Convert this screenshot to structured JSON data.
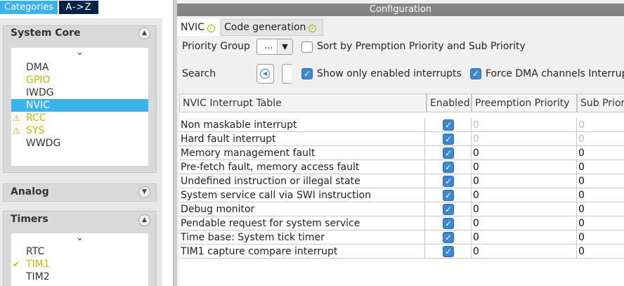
{
  "left": {
    "tabs": {
      "categories": "Categories",
      "az": "A->Z"
    },
    "system_core": {
      "title": "System Core",
      "items": [
        {
          "label": "DMA",
          "state": "normal"
        },
        {
          "label": "GPIO",
          "state": "ok-color"
        },
        {
          "label": "IWDG",
          "state": "normal"
        },
        {
          "label": "NVIC",
          "state": "selected"
        },
        {
          "label": "RCC",
          "state": "warning"
        },
        {
          "label": "SYS",
          "state": "warning"
        },
        {
          "label": "WWDG",
          "state": "normal"
        }
      ]
    },
    "analog": {
      "title": "Analog"
    },
    "timers": {
      "title": "Timers",
      "items": [
        {
          "label": "RTC",
          "state": "normal"
        },
        {
          "label": "TIM1",
          "state": "ok"
        },
        {
          "label": "TIM2",
          "state": "normal"
        }
      ]
    }
  },
  "config": {
    "title": "Configuration",
    "tabs": [
      {
        "label": "NVIC",
        "status": "ok"
      },
      {
        "label": "Code generation",
        "status": "ok"
      }
    ],
    "priority_group": {
      "label": "Priority Group",
      "value": "..."
    },
    "sort_option": {
      "label": "Sort by Premption Priority and Sub Priority",
      "checked": false
    },
    "search": {
      "label": "Search"
    },
    "show_enabled": {
      "label": "Show only enabled interrupts",
      "checked": true
    },
    "force_dma": {
      "label": "Force DMA channels Interrup",
      "checked": true
    },
    "table": {
      "headers": [
        "NVIC Interrupt Table",
        "Enabled",
        "Preemption Priority",
        "Sub Priority"
      ],
      "rows": [
        {
          "name": "Non maskable interrupt",
          "enabled": true,
          "preemption": "0",
          "sub": "0",
          "editable": false
        },
        {
          "name": "Hard fault interrupt",
          "enabled": true,
          "preemption": "0",
          "sub": "0",
          "editable": false
        },
        {
          "name": "Memory management fault",
          "enabled": true,
          "preemption": "0",
          "sub": "0",
          "editable": true
        },
        {
          "name": "Pre-fetch fault, memory access fault",
          "enabled": true,
          "preemption": "0",
          "sub": "0",
          "editable": true
        },
        {
          "name": "Undefined instruction or illegal state",
          "enabled": true,
          "preemption": "0",
          "sub": "0",
          "editable": true
        },
        {
          "name": "System service call via SWI instruction",
          "enabled": true,
          "preemption": "0",
          "sub": "0",
          "editable": true
        },
        {
          "name": "Debug monitor",
          "enabled": true,
          "preemption": "0",
          "sub": "0",
          "editable": true
        },
        {
          "name": "Pendable request for system service",
          "enabled": true,
          "preemption": "0",
          "sub": "0",
          "editable": true
        },
        {
          "name": "Time base: System tick timer",
          "enabled": true,
          "preemption": "0",
          "sub": "0",
          "editable": true
        },
        {
          "name": "TIM1 capture compare interrupt",
          "enabled": true,
          "preemption": "0",
          "sub": "0",
          "editable": true
        }
      ]
    }
  },
  "colors": {
    "accent": "#39b3e9",
    "navy": "#03234b",
    "warning": "#e8a800",
    "ok": "#b3c900",
    "checkbox": "#3c87d1"
  }
}
